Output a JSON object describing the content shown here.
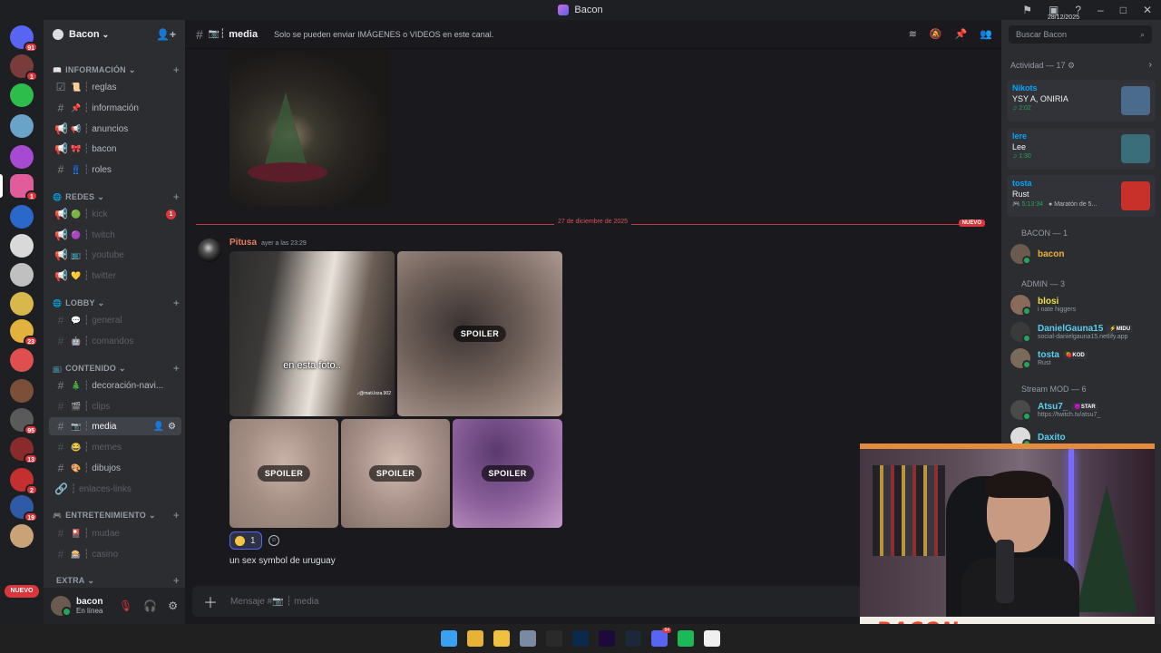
{
  "window": {
    "title": "Bacon"
  },
  "guilds": [
    {
      "badge": "91",
      "color": "#5865f2"
    },
    {
      "badge": "1",
      "color": "#7a3b3b"
    },
    {
      "badge": "",
      "color": "#2dbd4a"
    },
    {
      "badge": "",
      "color": "#6aa3c8"
    },
    {
      "badge": "",
      "color": "#a64ad1"
    },
    {
      "badge": "1",
      "color": "#e05c9a"
    },
    {
      "badge": "",
      "color": "#2a68c9"
    },
    {
      "badge": "",
      "color": "#d9d9d9"
    },
    {
      "badge": "",
      "color": "#c0c0c0"
    },
    {
      "badge": "",
      "color": "#d8b84a"
    },
    {
      "badge": "23",
      "color": "#e3b23c"
    },
    {
      "badge": "",
      "color": "#e04f4f"
    },
    {
      "badge": "",
      "color": "#7c5038"
    },
    {
      "badge": "95",
      "color": "#5a5a5a"
    },
    {
      "badge": "13",
      "color": "#8a2b2b"
    },
    {
      "badge": "2",
      "color": "#c43030"
    },
    {
      "badge": "19",
      "color": "#2f5aa5"
    },
    {
      "badge": "",
      "color": "#c9a377"
    }
  ],
  "guild_nuevo": "NUEVO",
  "server": {
    "name": "Bacon"
  },
  "categories": [
    {
      "emoji": "📖",
      "name": "INFORMACIÓN"
    },
    {
      "emoji": "🌐",
      "name": "REDES"
    },
    {
      "emoji": "🌐",
      "name": "LOBBY"
    },
    {
      "emoji": "📺",
      "name": "CONTENIDO"
    },
    {
      "emoji": "🎮",
      "name": "ENTRETENIMIENTO"
    },
    {
      "emoji": "",
      "name": "EXTRA"
    }
  ],
  "channels": [
    {
      "name": "reglas",
      "emoji": "📜",
      "kind": "☑",
      "muted": false
    },
    {
      "name": "información",
      "emoji": "📌",
      "kind": "#",
      "muted": false
    },
    {
      "name": "anuncios",
      "emoji": "📢",
      "kind": "📢",
      "muted": false
    },
    {
      "name": "bacon",
      "emoji": "🎀",
      "kind": "📢",
      "muted": false
    },
    {
      "name": "roles",
      "emoji": "👖",
      "kind": "#",
      "muted": false
    },
    {
      "name": "kick",
      "emoji": "🟢",
      "kind": "📢",
      "muted": true,
      "unread": "1"
    },
    {
      "name": "twitch",
      "emoji": "🟣",
      "kind": "📢",
      "muted": true
    },
    {
      "name": "youtube",
      "emoji": "📺",
      "kind": "📢",
      "muted": true
    },
    {
      "name": "twitter",
      "emoji": "💛",
      "kind": "📢",
      "muted": true
    },
    {
      "name": "general",
      "emoji": "💬",
      "kind": "#",
      "muted": true
    },
    {
      "name": "comandos",
      "emoji": "🤖",
      "kind": "#",
      "muted": true
    },
    {
      "name": "decoración-navi...",
      "emoji": "🎄",
      "kind": "#",
      "muted": false
    },
    {
      "name": "clips",
      "emoji": "🎬",
      "kind": "#",
      "muted": true
    },
    {
      "name": "media",
      "emoji": "📷",
      "kind": "#",
      "muted": false,
      "active": true
    },
    {
      "name": "memes",
      "emoji": "😂",
      "kind": "#",
      "muted": true
    },
    {
      "name": "dibujos",
      "emoji": "🎨",
      "kind": "#",
      "muted": false
    },
    {
      "name": "enlaces-links",
      "emoji": "",
      "kind": "🔗",
      "muted": true
    },
    {
      "name": "mudae",
      "emoji": "🎴",
      "kind": "#",
      "muted": true
    },
    {
      "name": "casino",
      "emoji": "🎰",
      "kind": "#",
      "muted": true
    }
  ],
  "user": {
    "name": "bacon",
    "status": "En línea"
  },
  "chat": {
    "channel_name": "media",
    "topic": "Solo se pueden enviar IMÁGENES o VIDEOS en este canal.",
    "divider_date": "27 de diciembre de 2025",
    "new_label": "NUEVO",
    "author": "Pitusa",
    "timestamp": "ayer a las 23:29",
    "image_caption": "en esta foto..",
    "image_watermark": "♪@mati.loza.902",
    "spoiler_label": "SPOILER",
    "reaction_count": "1",
    "message": "un sex symbol de uruguay",
    "composer_placeholder": "Mensaje #📷 ┆ media"
  },
  "members": {
    "search_placeholder": "Buscar Bacon",
    "activity_title": "Actividad — 17",
    "activities": [
      {
        "name": "Nikots",
        "title": "YSY A, ONIRIA",
        "detail": "♫ 2:02",
        "extra": "",
        "thumb": "#4a6b8c"
      },
      {
        "name": "lere",
        "title": "Lee",
        "detail": "♫ 1:30",
        "extra": "",
        "thumb": "#3a6e7a"
      },
      {
        "name": "tosta",
        "title": "Rust",
        "detail": "🎮 5:13:34",
        "extra": "● Maratón de 5...",
        "thumb": "#c8302a"
      }
    ],
    "groups": [
      {
        "title": "BACON — 1",
        "items": [
          {
            "name": "bacon",
            "color": "#f0b232",
            "tag": "",
            "sub": "",
            "av": "#6b5a4e"
          }
        ]
      },
      {
        "title": "ADMIN — 3",
        "items": [
          {
            "name": "blosi",
            "color": "#f0e040",
            "tag": "",
            "sub": "i nate higgers",
            "av": "#8a6a5a"
          },
          {
            "name": "DanielGauna15",
            "color": "#5ad0f0",
            "tag": "⚡MIDU",
            "sub": "social-danielgauna15.netlify.app",
            "av": "#3a3a3a"
          },
          {
            "name": "tosta",
            "color": "#5ad0f0",
            "tag": "🍓KOD",
            "sub": "Rust",
            "av": "#7a6a5a"
          }
        ]
      },
      {
        "title": "Stream MOD — 6",
        "items": [
          {
            "name": "Atsu7_",
            "color": "#5ad0f0",
            "tag": "😈STAR",
            "sub": "https://twitch.tv/atsu7_",
            "av": "#4a4a4a"
          },
          {
            "name": "Daxito",
            "color": "#5ad0f0",
            "tag": "",
            "sub": "",
            "av": "#dcdcdc"
          }
        ]
      }
    ]
  },
  "stream_overlay": {
    "brand": "BACON"
  },
  "taskbar": {
    "apps": [
      {
        "name": "windows-start-icon",
        "color": "#3aa0f0"
      },
      {
        "name": "chrome-icon",
        "color": "#e8b334"
      },
      {
        "name": "file-explorer-icon",
        "color": "#f0c040"
      },
      {
        "name": "snipping-tool-icon",
        "color": "#7a8aa0"
      },
      {
        "name": "obs-icon",
        "color": "#2a2a2a"
      },
      {
        "name": "photoshop-icon",
        "color": "#0b2a4a"
      },
      {
        "name": "premiere-icon",
        "color": "#1d0a3a"
      },
      {
        "name": "steam-icon",
        "color": "#1b2838"
      },
      {
        "name": "discord-icon",
        "color": "#5865f2",
        "badge": "94"
      },
      {
        "name": "spotify-icon",
        "color": "#1db954"
      },
      {
        "name": "notion-icon",
        "color": "#f0f0f0"
      }
    ],
    "clock": "28/12/2025"
  }
}
